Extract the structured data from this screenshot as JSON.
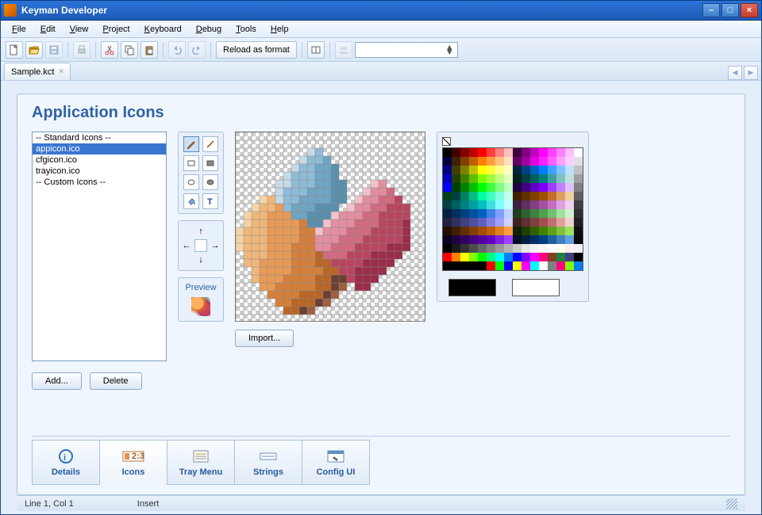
{
  "window": {
    "title": "Keyman Developer"
  },
  "menubar": [
    {
      "label": "File",
      "u": "F"
    },
    {
      "label": "Edit",
      "u": "E"
    },
    {
      "label": "View",
      "u": "V"
    },
    {
      "label": "Project",
      "u": "P"
    },
    {
      "label": "Keyboard",
      "u": "K"
    },
    {
      "label": "Debug",
      "u": "D"
    },
    {
      "label": "Tools",
      "u": "T"
    },
    {
      "label": "Help",
      "u": "H"
    }
  ],
  "toolbar": {
    "reload_label": "Reload as format",
    "combo_value": ""
  },
  "document_tab": {
    "name": "Sample.kct"
  },
  "page": {
    "title": "Application Icons",
    "icon_list": [
      {
        "label": "-- Standard Icons --",
        "selected": false
      },
      {
        "label": "appicon.ico",
        "selected": true
      },
      {
        "label": "cfgicon.ico",
        "selected": false
      },
      {
        "label": "trayicon.ico",
        "selected": false
      },
      {
        "label": "-- Custom Icons --",
        "selected": false
      }
    ],
    "buttons": {
      "add": "Add...",
      "delete": "Delete",
      "import": "Import..."
    },
    "preview_label": "Preview",
    "fg_color": "#000000",
    "bg_color": "#ffffff"
  },
  "bottom_tabs": [
    {
      "label": "Details",
      "active": false
    },
    {
      "label": "Icons",
      "active": true
    },
    {
      "label": "Tray Menu",
      "active": false
    },
    {
      "label": "Strings",
      "active": false
    },
    {
      "label": "Config UI",
      "active": false
    }
  ],
  "status": {
    "pos": "Line 1, Col 1",
    "mode": "Insert"
  },
  "pixel_art": {
    "cols": 24,
    "rows": 24,
    "cell": 10,
    "palette_map": {
      ".": null,
      "a": "#8fbcd7",
      "b": "#6fa4c3",
      "c": "#5a8fae",
      "d": "#c5dbe7",
      "e": "#f0b77b",
      "f": "#e79a57",
      "g": "#d47f3a",
      "h": "#b96526",
      "i": "#f6d3a6",
      "j": "#e38ea0",
      "k": "#d16a80",
      "l": "#b94560",
      "m": "#9a2d49",
      "n": "#f2c1cb",
      "o": "#6a4030",
      "p": "#a06040"
    },
    "rows_data": [
      "........................",
      "........................",
      ".........da.............",
      "........daab............",
      ".......daabbc...........",
      "......daaabbc...........",
      ".....ddaaabbcc...nj.....",
      ".....daaabbbcc..njjk....",
      "...iedaabbbbcc.njjkkl...",
      "..ieefabbbccc.njjkklll..",
      ".ieefffbbcccnjjjkkllll..",
      ".ieeffffgccnjjjkkklllm..",
      "ieeeffffggnjjjkkkllllm..",
      "ieeeffffggjjjkkklllllm..",
      "ieeefffgggjjkkkllllmmm..",
      ".eeefffggghkkklllmmmm...",
      ".eeffffggghhllllmmmm....",
      "..effffgggghhllmmmm.....",
      "..efffgggghhoolmmm......",
      "...ffggggghhop.mm.......",
      "....gggghhhop...........",
      ".....gghhhop............",
      "......hhop..............",
      "........................"
    ]
  },
  "color_palette_rows": [
    [
      "#000000",
      "#400000",
      "#800000",
      "#c00000",
      "#ff0000",
      "#ff4040",
      "#ff8080",
      "#ffc0c0",
      "#400040",
      "#800080",
      "#c000c0",
      "#ff00ff",
      "#ff40ff",
      "#ff80ff",
      "#ffc0ff",
      "#ffffff"
    ],
    [
      "#000040",
      "#402000",
      "#804000",
      "#c06000",
      "#ff8000",
      "#ffa040",
      "#ffc080",
      "#ffe0c0",
      "#600060",
      "#a000a0",
      "#e000e0",
      "#ff20ff",
      "#ff60ff",
      "#ffa0ff",
      "#ffd0ff",
      "#e0e0e0"
    ],
    [
      "#000080",
      "#404000",
      "#808000",
      "#c0c000",
      "#ffff00",
      "#ffff40",
      "#ffff80",
      "#ffffc0",
      "#002040",
      "#004080",
      "#0060c0",
      "#0080ff",
      "#40a0ff",
      "#80c0ff",
      "#c0e0ff",
      "#c0c0c0"
    ],
    [
      "#0000c0",
      "#204000",
      "#408000",
      "#60c000",
      "#80ff00",
      "#a0ff40",
      "#c0ff80",
      "#e0ffc0",
      "#002020",
      "#004040",
      "#006060",
      "#008080",
      "#40a0a0",
      "#80c0c0",
      "#c0e0e0",
      "#a0a0a0"
    ],
    [
      "#0000ff",
      "#004000",
      "#008000",
      "#00c000",
      "#00ff00",
      "#40ff40",
      "#80ff80",
      "#c0ffc0",
      "#200040",
      "#400080",
      "#6000c0",
      "#8000ff",
      "#a040ff",
      "#c080ff",
      "#e0c0ff",
      "#808080"
    ],
    [
      "#004020",
      "#004040",
      "#008060",
      "#00c080",
      "#00ffa0",
      "#40ffc0",
      "#80ffe0",
      "#c0fff0",
      "#402000",
      "#603000",
      "#804000",
      "#a05000",
      "#c07030",
      "#e0a060",
      "#f0d0a0",
      "#606060"
    ],
    [
      "#004040",
      "#006060",
      "#008080",
      "#00a0a0",
      "#00c0c0",
      "#40e0e0",
      "#80ffff",
      "#c0ffff",
      "#402040",
      "#603060",
      "#804080",
      "#a050a0",
      "#c070c0",
      "#e0a0e0",
      "#f0d0f0",
      "#404040"
    ],
    [
      "#002040",
      "#003060",
      "#004080",
      "#0050a0",
      "#0060c0",
      "#4080e0",
      "#80a0ff",
      "#c0d0ff",
      "#204020",
      "#306030",
      "#408040",
      "#50a050",
      "#70c070",
      "#a0e0a0",
      "#d0f0d0",
      "#303030"
    ],
    [
      "#202040",
      "#303060",
      "#404080",
      "#5050a0",
      "#6060c0",
      "#8080e0",
      "#a0a0ff",
      "#d0d0ff",
      "#402020",
      "#603030",
      "#804040",
      "#a05050",
      "#c07070",
      "#e0a0a0",
      "#f0d0d0",
      "#202020"
    ],
    [
      "#201000",
      "#402000",
      "#603000",
      "#804000",
      "#a05000",
      "#c06000",
      "#e08020",
      "#ffa040",
      "#102000",
      "#204000",
      "#306000",
      "#408000",
      "#60a020",
      "#80c040",
      "#a0e060",
      "#101010"
    ],
    [
      "#100020",
      "#200040",
      "#300060",
      "#400080",
      "#5000a0",
      "#6000c0",
      "#8020e0",
      "#a040ff",
      "#001020",
      "#002040",
      "#003060",
      "#004080",
      "#2060a0",
      "#4080c0",
      "#60a0e0",
      "#0a0a0a"
    ],
    [
      "#000000",
      "#1a1a1a",
      "#333333",
      "#4d4d4d",
      "#666666",
      "#808080",
      "#999999",
      "#b3b3b3",
      "#cccccc",
      "#e6e6e6",
      "#f2f2f2",
      "#f8f8f8",
      "#ffffff",
      "#fffff0",
      "#fff0f0",
      "#f0f0ff"
    ],
    [
      "#ff0000",
      "#ff8000",
      "#ffff00",
      "#80ff00",
      "#00ff00",
      "#00ff80",
      "#00ffff",
      "#0080ff",
      "#0000ff",
      "#8000ff",
      "#ff00ff",
      "#ff0080",
      "#804020",
      "#208040",
      "#404080",
      "#000000"
    ],
    [
      "#000000",
      "#000000",
      "#000000",
      "#000000",
      "#000000",
      "#ff0000",
      "#00ff00",
      "#0000ff",
      "#ffff00",
      "#ff00ff",
      "#00ffff",
      "#ffffff",
      "#808080",
      "#ff0080",
      "#80ff00",
      "#0080ff"
    ]
  ]
}
